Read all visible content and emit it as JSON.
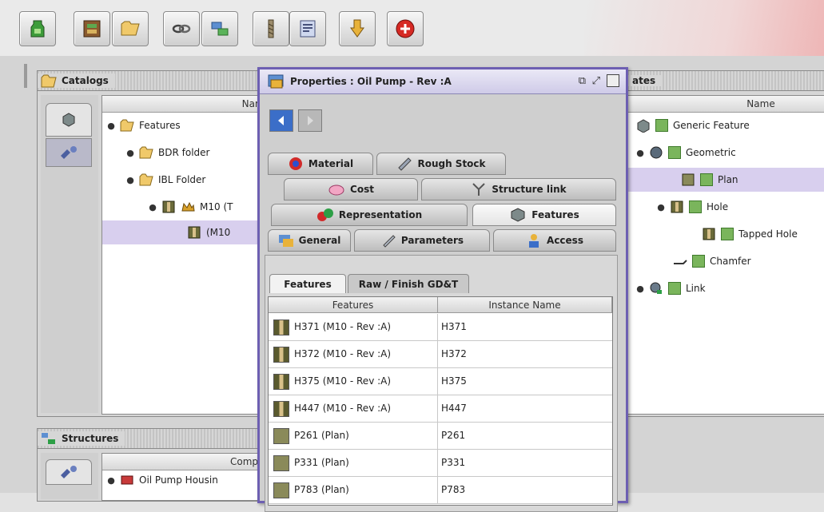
{
  "toolbar": {
    "buttons": [
      {
        "icon": "green-bottle-icon"
      },
      {
        "icon": "catalog-box-icon"
      },
      {
        "icon": "open-folder-icon"
      },
      {
        "icon": "link-chain-icon"
      },
      {
        "icon": "structure-tree-icon"
      },
      {
        "icon": "tool-bit-icon"
      },
      {
        "icon": "properties-list-icon"
      },
      {
        "icon": "hand-down-icon"
      },
      {
        "icon": "red-stop-icon"
      }
    ]
  },
  "catalogs_panel": {
    "title": "Catalogs",
    "column_header": "Name",
    "tree": [
      {
        "label": "Features"
      },
      {
        "label": "BDR folder"
      },
      {
        "label": "IBL Folder"
      },
      {
        "label": "M10 (T"
      },
      {
        "label": "(M10"
      }
    ]
  },
  "structures_panel": {
    "title": "Structures",
    "column_header": "Compon",
    "tree": [
      {
        "label": "Oil Pump Housin"
      }
    ]
  },
  "templates_panel": {
    "title": "ates",
    "column_header": "Name",
    "tree": [
      {
        "label": "Generic Feature"
      },
      {
        "label": "Geometric"
      },
      {
        "label": "Plan"
      },
      {
        "label": "Hole"
      },
      {
        "label": "Tapped Hole"
      },
      {
        "label": "Chamfer"
      },
      {
        "label": "Link"
      }
    ]
  },
  "properties": {
    "title": "Properties : Oil Pump - Rev :A",
    "tabs_row1": [
      "Material",
      "Rough Stock"
    ],
    "tabs_row2": [
      "Cost",
      "Structure link"
    ],
    "tabs_row3": [
      "Representation",
      "Features"
    ],
    "tabs_row4": [
      "General",
      "Parameters",
      "Access"
    ],
    "subtabs": [
      "Features",
      "Raw / Finish GD&T"
    ],
    "grid_headers": [
      "Features",
      "Instance Name"
    ],
    "rows": [
      {
        "feature": "H371 (M10 - Rev :A)",
        "instance": "H371",
        "kind": "hole"
      },
      {
        "feature": "H372 (M10 - Rev :A)",
        "instance": "H372",
        "kind": "hole"
      },
      {
        "feature": "H375 (M10 - Rev :A)",
        "instance": "H375",
        "kind": "hole"
      },
      {
        "feature": "H447 (M10 - Rev :A)",
        "instance": "H447",
        "kind": "hole"
      },
      {
        "feature": "P261 (Plan)",
        "instance": "P261",
        "kind": "plan"
      },
      {
        "feature": "P331 (Plan)",
        "instance": "P331",
        "kind": "plan"
      },
      {
        "feature": "P783 (Plan)",
        "instance": "P783",
        "kind": "plan"
      }
    ]
  },
  "colors": {
    "accent": "#6d5fb2",
    "selection": "#d8cfee",
    "check_green": "#7ab55c"
  }
}
